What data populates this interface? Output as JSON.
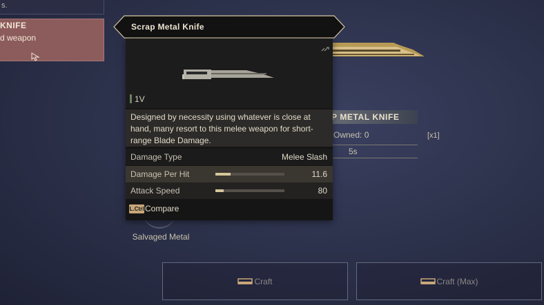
{
  "top_card": {
    "text": "s."
  },
  "selected_item": {
    "title": "KNIFE",
    "subtitle": "d weapon"
  },
  "tooltip": {
    "name": "Scrap Metal Knife",
    "level": "1V",
    "description": "Designed by necessity using whatever is close at hand, many resort to this melee weapon for short-range Blade Damage.",
    "stats": [
      {
        "label": "Damage Type",
        "value": "Melee Slash"
      },
      {
        "label": "Damage Per Hit",
        "value": "11.6",
        "bar_fraction": 0.22
      },
      {
        "label": "Attack Speed",
        "value": "80",
        "bar_fraction": 0.12
      }
    ],
    "compare_key": "L.Ctrl",
    "compare_label": "Compare"
  },
  "detail": {
    "name": "P METAL KNIFE",
    "owned": "Owned: 0",
    "multiplier": "[x1]",
    "time": "5s"
  },
  "ingredient": {
    "name": "Salvaged Metal"
  },
  "buttons": {
    "craft": "Craft",
    "craft_max": "Craft (Max)"
  },
  "colors": {
    "accent_gold": "#c7a779",
    "selected_card": "#8c5c5c",
    "panel_dark": "#151515"
  }
}
